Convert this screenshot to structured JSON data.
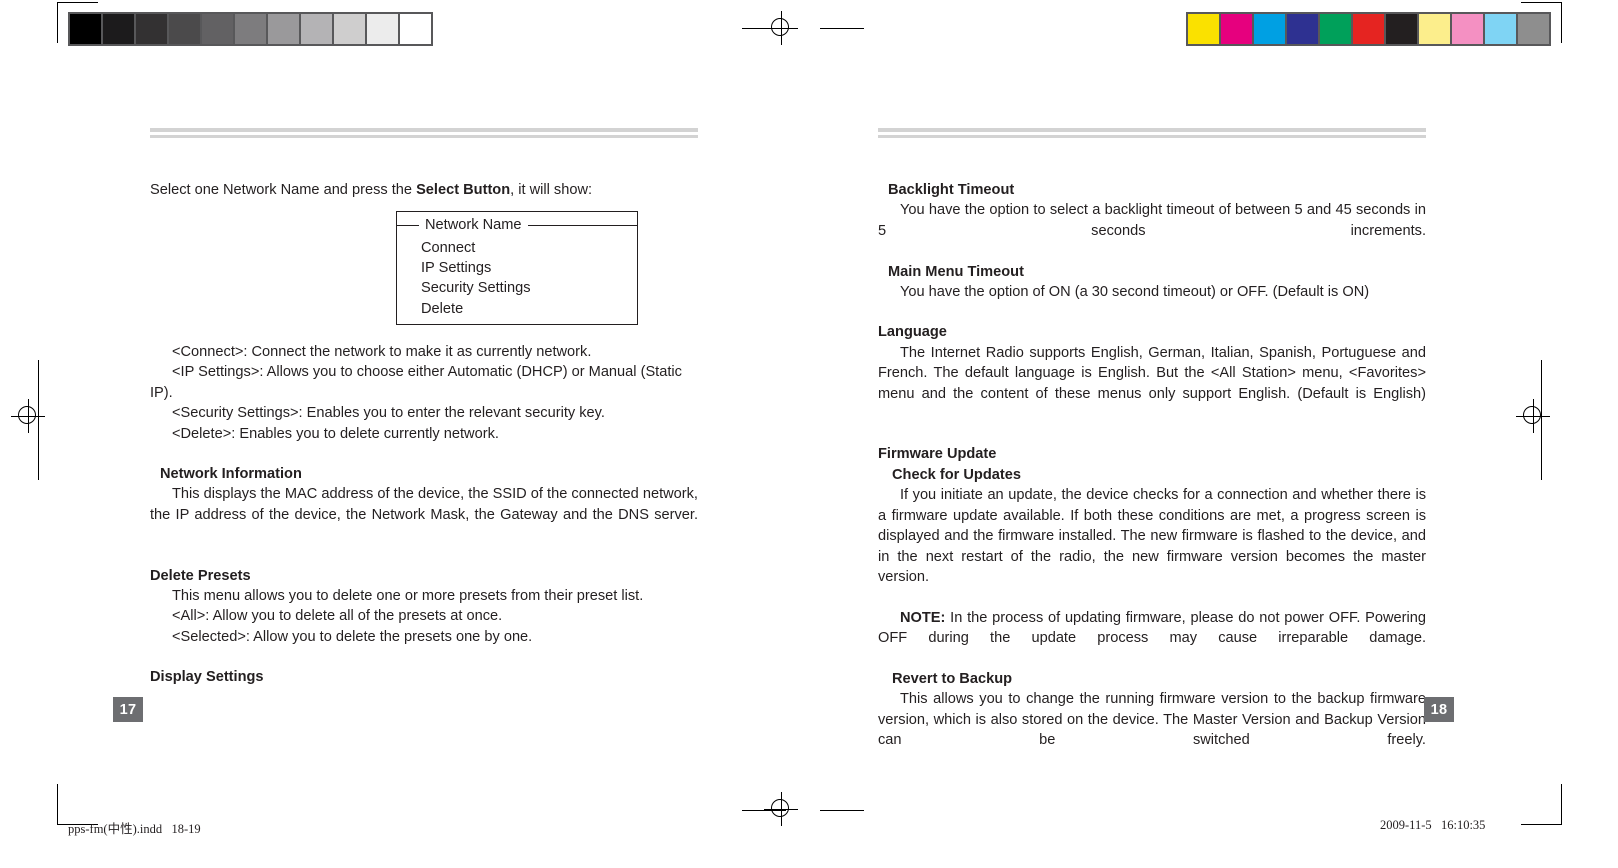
{
  "document": {
    "type": "printed-manual-spread",
    "footer_left": "pps-fm(中性).indd   18-19",
    "footer_right": "2009-11-5   16:10:35"
  },
  "calibration": {
    "gray_bar_name": "grayscale-calibration-bar",
    "gray_patches": [
      "#000000",
      "#1c1b1c",
      "#333132",
      "#4b4a4b",
      "#626163",
      "#7d7c7e",
      "#9a999b",
      "#b4b3b5",
      "#cfcece",
      "#ececec",
      "#ffffff"
    ],
    "color_bar_name": "color-calibration-bar",
    "color_patches": [
      "#fae100",
      "#e6007e",
      "#00a0e3",
      "#2e3191",
      "#00a05a",
      "#e52421",
      "#231f20",
      "#fcee8c",
      "#f490c2",
      "#7fd4f4",
      "#8e8e8e"
    ]
  },
  "left_page": {
    "page_number": "17",
    "intro": {
      "before": "Select one Network Name and press the ",
      "bold": "Select Button",
      "after": ", it will show:"
    },
    "menu_box": {
      "title": "Network Name",
      "items": [
        "Connect",
        "IP Settings",
        "Security Settings",
        "Delete"
      ]
    },
    "definitions": [
      "<Connect>: Connect the network to make it as currently network.",
      "<IP Settings>: Allows you to choose either Automatic (DHCP) or Manual (Static IP).",
      "<Security Settings>: Enables you to enter the relevant security key.",
      "<Delete>: Enables you to delete currently network."
    ],
    "network_information": {
      "heading": "Network Information",
      "body": "This displays the MAC address of the device, the SSID of the connected network, the IP address of the device, the Network Mask, the Gateway and the DNS server."
    },
    "delete_presets": {
      "heading": "Delete Presets",
      "body": "This menu allows you to delete one or more presets from their preset list.",
      "options": [
        "<All>: Allow you to delete all of the presets at once.",
        "<Selected>: Allow you to delete the presets one by one."
      ]
    },
    "display_settings": {
      "heading": "Display Settings"
    }
  },
  "right_page": {
    "page_number": "18",
    "backlight_timeout": {
      "heading": "Backlight Timeout",
      "body": "You have the option to select a backlight timeout of between 5 and 45 seconds in 5 seconds increments."
    },
    "main_menu_timeout": {
      "heading": "Main Menu Timeout",
      "body": "You have the option of ON (a 30 second timeout) or OFF. (Default is ON)"
    },
    "language": {
      "heading": "Language",
      "body": "The Internet Radio supports English, German, Italian, Spanish, Portuguese and French. The default language is English. But the <All Station> menu, <Favorites> menu and the content of these menus only support English. (Default is English)"
    },
    "firmware_update": {
      "heading": "Firmware Update",
      "check_for_updates": {
        "heading": "Check for Updates",
        "body": "If you initiate an update, the device checks for a connection and whether there is a firmware update available. If both these conditions are met, a progress screen is displayed and the firmware installed. The new firmware is flashed to the device, and in the next restart of the radio, the new firmware version becomes the master version."
      },
      "note": {
        "label": "NOTE:",
        "body": " In the process of updating firmware, please do not power OFF. Powering OFF during the update process may cause irreparable damage."
      },
      "revert_to_backup": {
        "heading": "Revert to Backup",
        "body": "This allows you to change the running firmware version to the backup firmware version, which is also stored on the device. The Master Version and Backup Version can be switched freely."
      }
    }
  }
}
